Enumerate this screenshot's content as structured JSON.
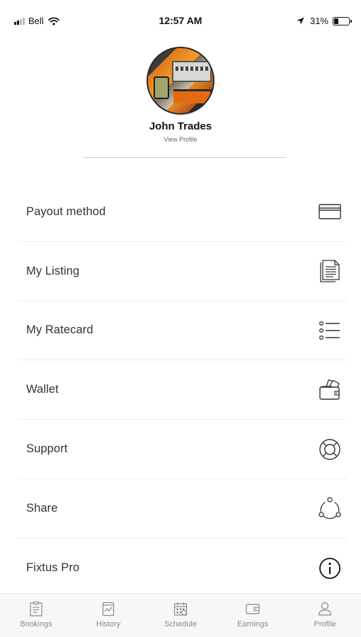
{
  "status_bar": {
    "carrier": "Bell",
    "time": "12:57 AM",
    "battery": "31%"
  },
  "profile": {
    "name": "John Trades",
    "view_profile": "View Profile"
  },
  "menu": {
    "items": [
      {
        "label": "Payout method",
        "icon": "credit-card-icon"
      },
      {
        "label": "My Listing",
        "icon": "document-icon"
      },
      {
        "label": "My Ratecard",
        "icon": "list-icon"
      },
      {
        "label": "Wallet",
        "icon": "wallet-icon"
      },
      {
        "label": "Support",
        "icon": "lifebuoy-icon"
      },
      {
        "label": "Share",
        "icon": "share-icon"
      },
      {
        "label": "Fixtus Pro",
        "icon": "info-icon"
      }
    ]
  },
  "tab_bar": {
    "tabs": [
      {
        "label": "Bookings",
        "icon": "clipboard-icon"
      },
      {
        "label": "History",
        "icon": "history-icon"
      },
      {
        "label": "Schedule",
        "icon": "calendar-icon"
      },
      {
        "label": "Earnings",
        "icon": "wallet-icon"
      },
      {
        "label": "Profile",
        "icon": "person-icon"
      }
    ]
  },
  "colors": {
    "icon": "#333333",
    "tab_inactive": "#8a8a8a",
    "divider": "#ececec"
  }
}
